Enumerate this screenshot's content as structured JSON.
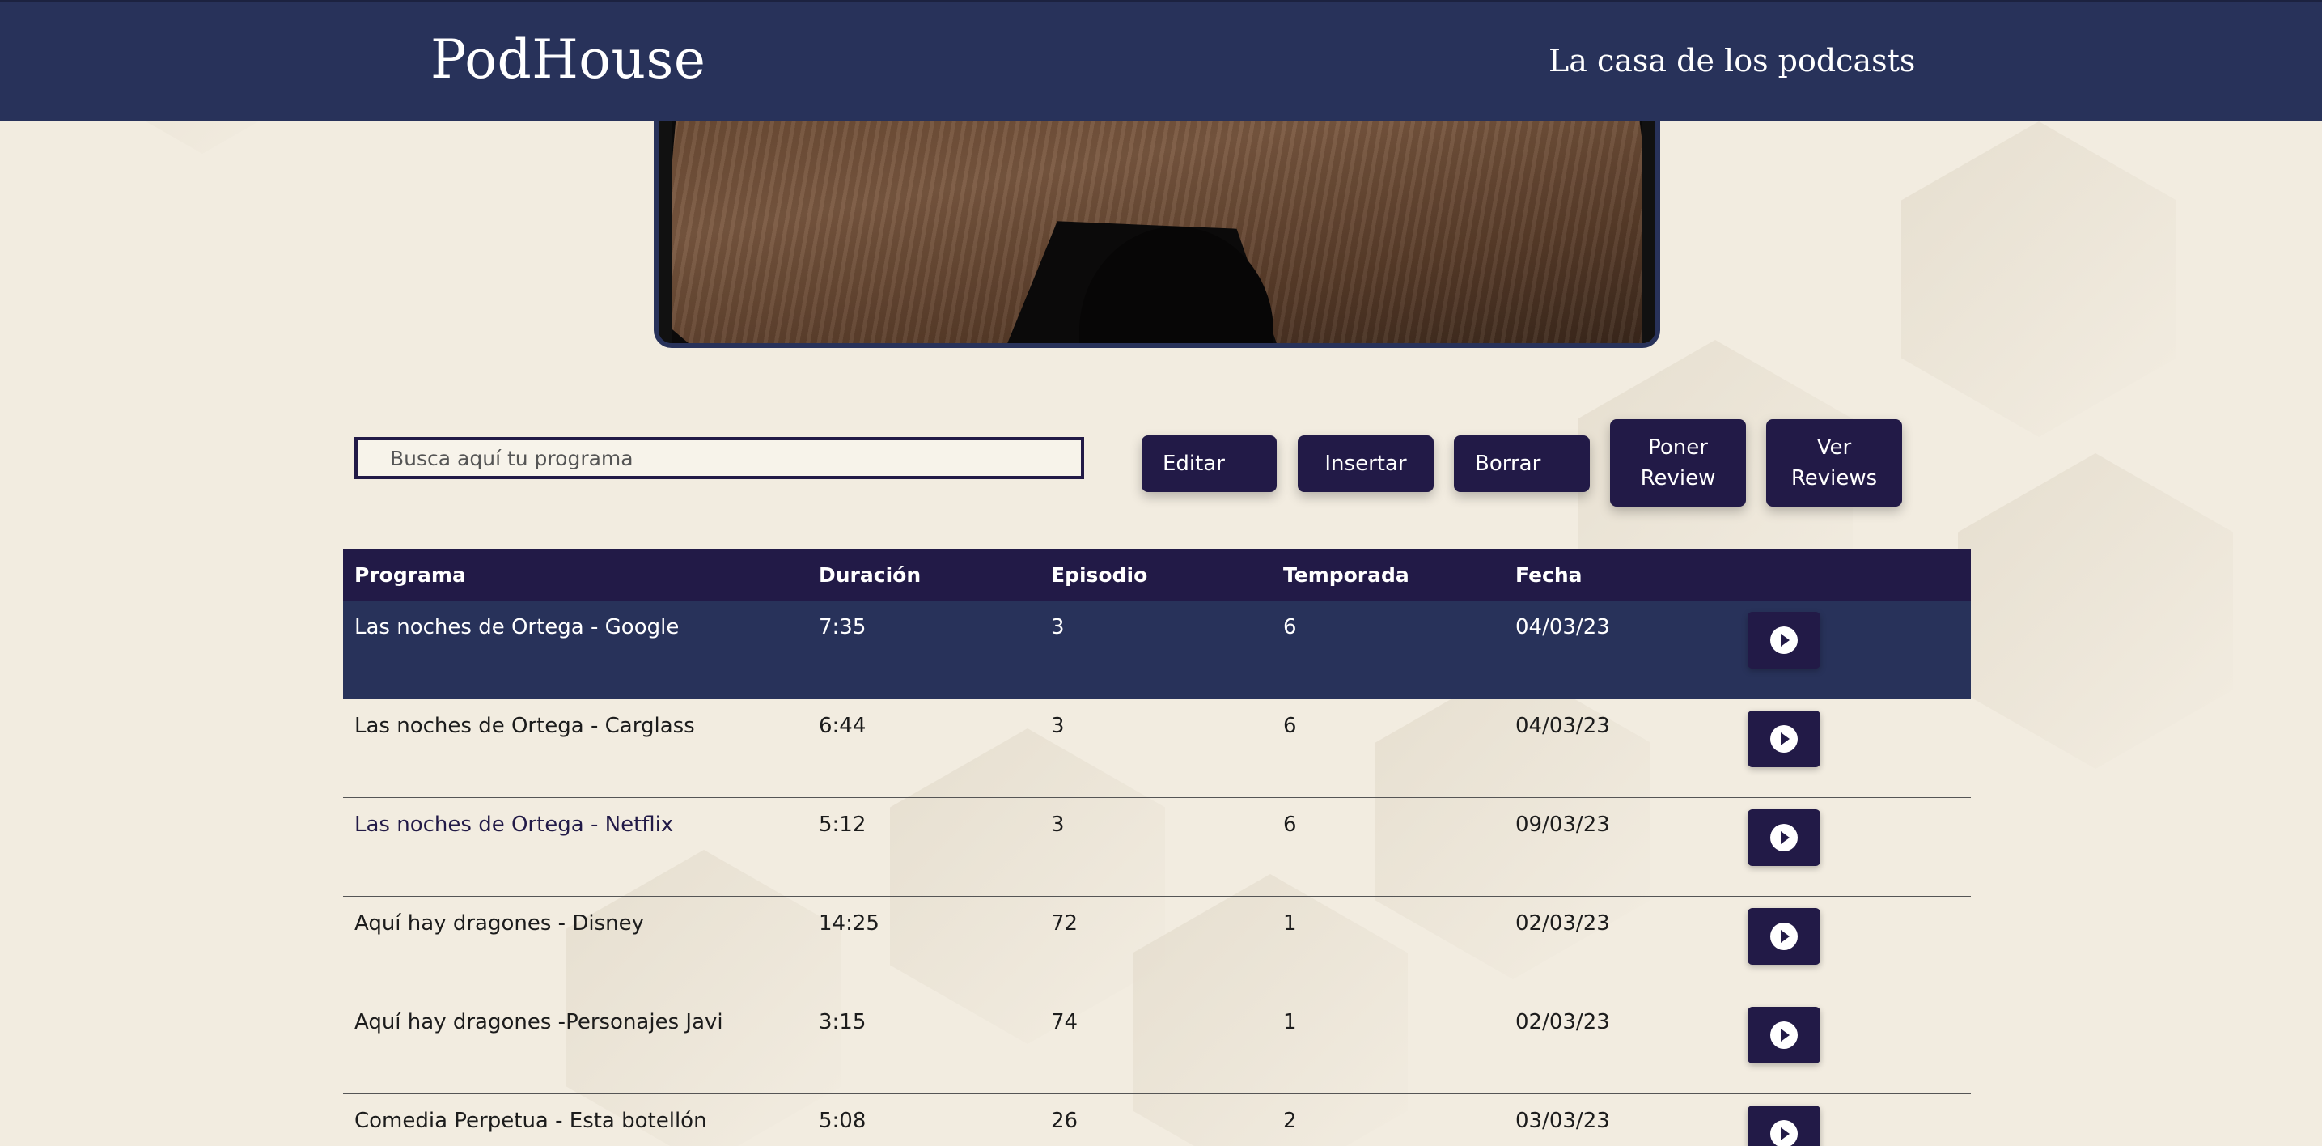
{
  "header": {
    "brand": "PodHouse",
    "tagline": "La casa de los podcasts"
  },
  "hero": {
    "alt": "Mesa de estudio de podcast"
  },
  "search": {
    "placeholder": "Busca aquí tu programa",
    "value": ""
  },
  "toolbar": {
    "edit_label": "Editar",
    "insert_label": "Insertar",
    "delete_label": "Borrar",
    "review_line1": "Poner",
    "review_line2": "Review",
    "reviews_line1": "Ver",
    "reviews_line2": "Reviews"
  },
  "table": {
    "headers": [
      "Programa",
      "Duración",
      "Episodio",
      "Temporada",
      "Fecha"
    ],
    "rows": [
      {
        "programa": "Las noches de Ortega - Google",
        "duracion": "7:35",
        "episodio": "3",
        "temporada": "6",
        "fecha": "04/03/23",
        "selected": true
      },
      {
        "programa": "Las noches de Ortega - Carglass",
        "duracion": "6:44",
        "episodio": "3",
        "temporada": "6",
        "fecha": "04/03/23"
      },
      {
        "programa": "Las noches de Ortega - Netflix",
        "duracion": "5:12",
        "episodio": "3",
        "temporada": "6",
        "fecha": "09/03/23"
      },
      {
        "programa": "Aquí hay dragones - Disney",
        "duracion": "14:25",
        "episodio": "72",
        "temporada": "1",
        "fecha": "02/03/23"
      },
      {
        "programa": "Aquí hay dragones -Personajes Javi",
        "duracion": "3:15",
        "episodio": "74",
        "temporada": "1",
        "fecha": "02/03/23"
      },
      {
        "programa": "Comedia Perpetua - Esta botellón",
        "duracion": "5:08",
        "episodio": "26",
        "temporada": "2",
        "fecha": "03/03/23"
      }
    ]
  },
  "colors": {
    "header_bg": "#28325a",
    "button_bg": "#221a47",
    "page_bg": "#f2ece0"
  },
  "icons": {
    "play": "play-circle-icon"
  }
}
